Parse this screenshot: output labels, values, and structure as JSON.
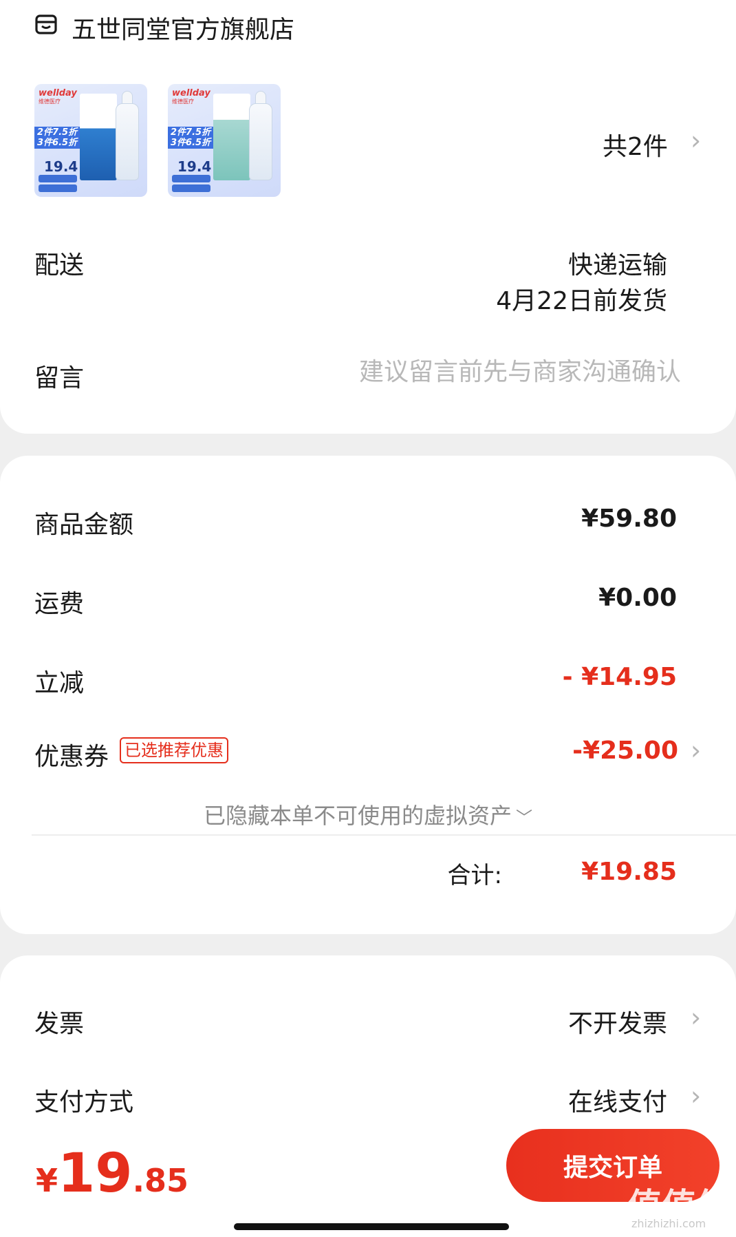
{
  "store": {
    "name": "五世同堂官方旗舰店",
    "icon": "store-icon"
  },
  "products": {
    "thumbnails": [
      {
        "brand": "wellday",
        "brand_sub": "维德医疗",
        "promo_line1": "2件7.5折",
        "promo_line2": "3件6.5折",
        "price": "19.4"
      },
      {
        "brand": "wellday",
        "brand_sub": "维德医疗",
        "promo_line1": "2件7.5折",
        "promo_line2": "3件6.5折",
        "price": "19.4"
      }
    ],
    "count_label": "共2件"
  },
  "delivery": {
    "label": "配送",
    "method": "快递运输",
    "date": "4月22日前发货"
  },
  "note": {
    "label": "留言",
    "placeholder": "建议留言前先与商家沟通确认"
  },
  "pricing": {
    "goods_label": "商品金额",
    "goods_amount": "¥59.80",
    "shipping_label": "运费",
    "shipping_amount": "¥0.00",
    "discount_label": "立减",
    "discount_amount": "- ¥14.95",
    "coupon_label": "优惠券",
    "coupon_badge": "已选推荐优惠",
    "coupon_amount": "-¥25.00",
    "hidden_assets": "已隐藏本单不可使用的虚拟资产",
    "subtotal_label": "合计:",
    "subtotal_amount": "¥19.85"
  },
  "invoice": {
    "label": "发票",
    "value": "不开发票"
  },
  "payment": {
    "label": "支付方式",
    "value": "在线支付"
  },
  "footer": {
    "total_yen": "¥",
    "total_int": "19",
    "total_dec": ".85",
    "submit_label": "提交订单"
  },
  "watermark": {
    "text": "值值值",
    "url": "zhizhizhi.com"
  },
  "colors": {
    "accent_red": "#e52e1c",
    "background": "#efefef",
    "card": "#ffffff"
  }
}
